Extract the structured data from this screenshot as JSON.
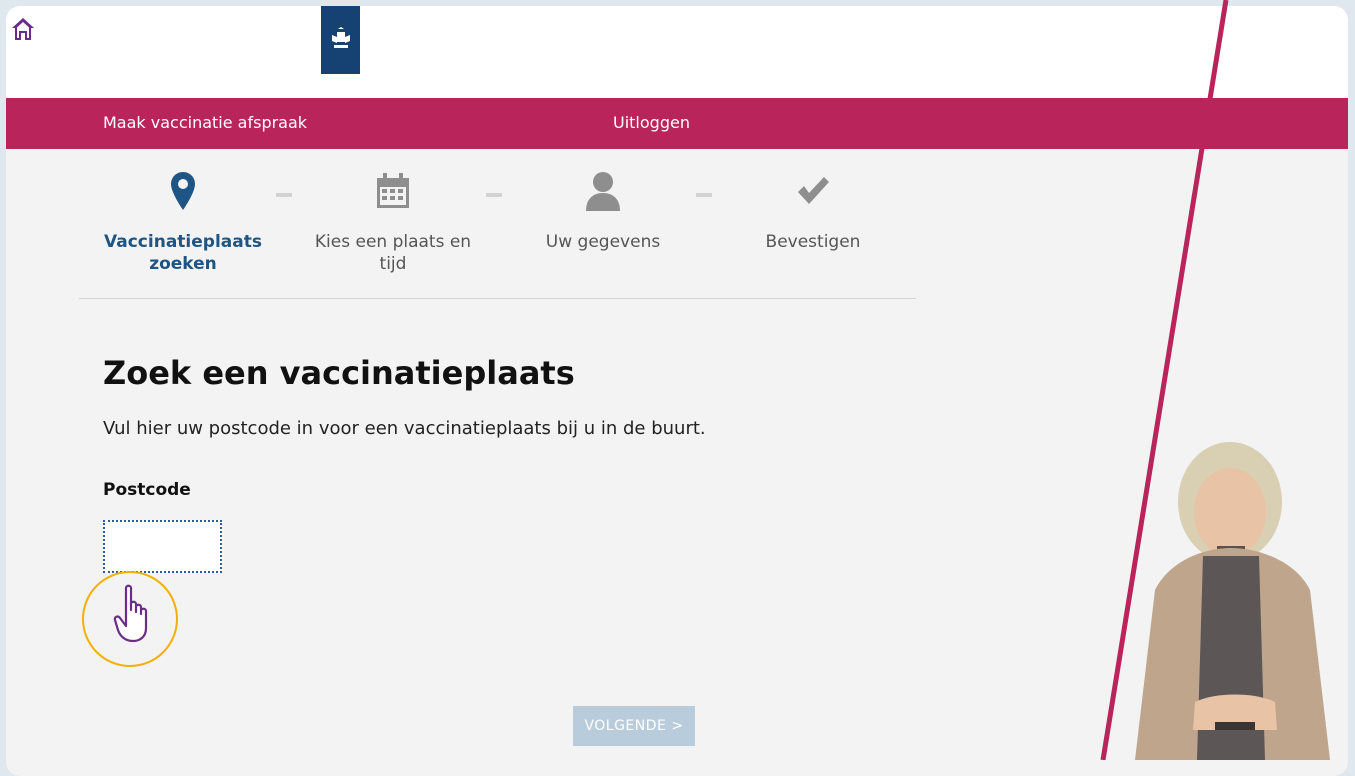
{
  "header": {
    "home_icon": "home-icon",
    "logo": "rijksoverheid-logo"
  },
  "nav": {
    "left_link": "Maak vaccinatie afspraak",
    "right_link": "Uitloggen"
  },
  "steps": [
    {
      "icon": "map-pin-icon",
      "label": "Vaccinatieplaats zoeken",
      "active": true
    },
    {
      "icon": "calendar-icon",
      "label": "Kies een plaats en tijd",
      "active": false
    },
    {
      "icon": "person-icon",
      "label": "Uw gegevens",
      "active": false
    },
    {
      "icon": "checkmark-icon",
      "label": "Bevestigen",
      "active": false
    }
  ],
  "main": {
    "title": "Zoek een vaccinatieplaats",
    "intro": "Vul hier uw postcode in voor een vaccinatieplaats bij u in de buurt.",
    "postcode_label": "Postcode",
    "postcode_value": "",
    "next_button": "VOLGENDE >"
  },
  "colors": {
    "brand_red": "#b9245b",
    "active_blue": "#1f5584",
    "logo_blue": "#154273",
    "cursor_ring": "#f3b000",
    "button_disabled": "#b8ccdc"
  }
}
